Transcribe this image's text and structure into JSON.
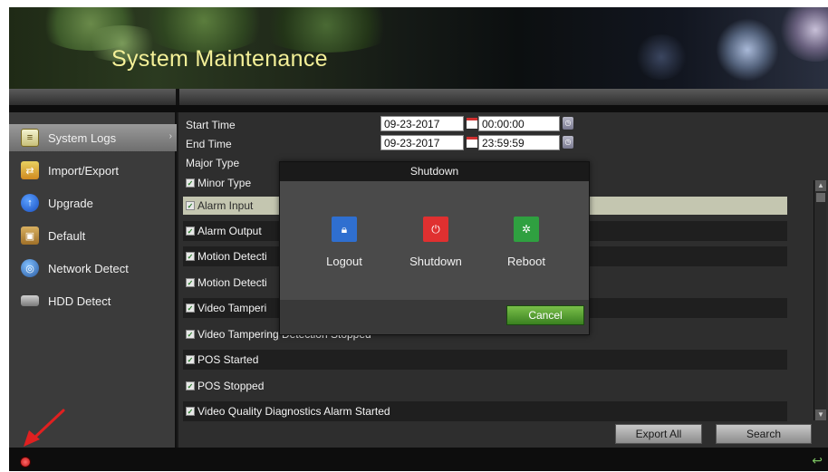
{
  "header": {
    "title": "System Maintenance"
  },
  "sidebar": {
    "items": [
      {
        "label": "System Logs",
        "icon": "system-logs-icon",
        "active": true
      },
      {
        "label": "Import/Export",
        "icon": "import-export-icon"
      },
      {
        "label": "Upgrade",
        "icon": "upgrade-icon"
      },
      {
        "label": "Default",
        "icon": "default-icon"
      },
      {
        "label": "Network Detect",
        "icon": "network-detect-icon"
      },
      {
        "label": "HDD Detect",
        "icon": "hdd-detect-icon"
      }
    ]
  },
  "search_form": {
    "start_time_label": "Start Time",
    "start_date": "09-23-2017",
    "start_time": "00:00:00",
    "end_time_label": "End Time",
    "end_date": "09-23-2017",
    "end_time": "23:59:59",
    "major_type_label": "Major Type",
    "minor_type_label": "Minor Type"
  },
  "log_types": [
    {
      "label": "Alarm Input",
      "selected": true
    },
    {
      "label": "Alarm Output"
    },
    {
      "label": "Motion Detecti"
    },
    {
      "label": "Motion Detecti"
    },
    {
      "label": "Video Tamperi"
    },
    {
      "label": "Video Tampering Detection Stopped"
    },
    {
      "label": "POS Started"
    },
    {
      "label": "POS Stopped"
    },
    {
      "label": "Video Quality Diagnostics Alarm Started"
    }
  ],
  "buttons": {
    "export_all": "Export All",
    "search": "Search"
  },
  "dialog": {
    "title": "Shutdown",
    "options": [
      {
        "label": "Logout",
        "icon": "lock-icon",
        "color": "#2f6fd0"
      },
      {
        "label": "Shutdown",
        "icon": "power-icon",
        "color": "#e03030"
      },
      {
        "label": "Reboot",
        "icon": "reboot-icon",
        "color": "#2fa040"
      }
    ],
    "cancel": "Cancel"
  },
  "colors": {
    "title": "#f4f098",
    "cancel_button": "#5aa030",
    "annotation_arrow": "#e02020"
  }
}
